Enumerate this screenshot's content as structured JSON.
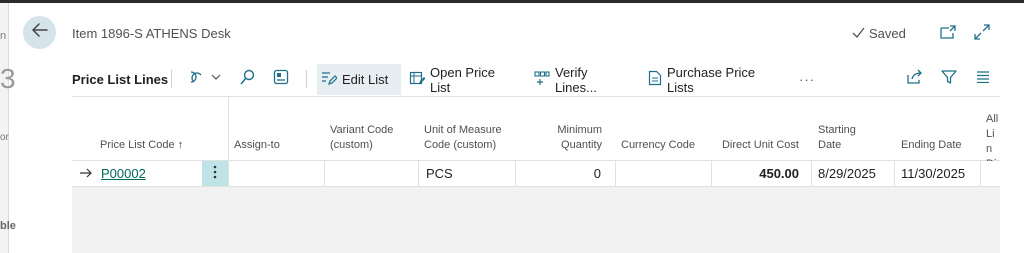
{
  "header": {
    "title": "Item 1896-S ATHENS Desk",
    "status": "Saved"
  },
  "left_fragments": [
    "n",
    "3",
    "or",
    "ble"
  ],
  "toolbar": {
    "title": "Price List Lines",
    "edit_list": "Edit List",
    "open_price_list": "Open Price List",
    "verify_lines": "Verify Lines...",
    "purchase_price_lists": "Purchase Price Lists",
    "more": "···"
  },
  "columns": {
    "price_list_code": "Price List Code",
    "sort_indicator": "↑",
    "assign_to": "Assign-to",
    "variant_code": "Variant Code (custom)",
    "unit_of_measure": "Unit of Measure Code (custom)",
    "min_quantity": "Minimum Quantity",
    "currency_code": "Currency Code",
    "direct_unit_cost": "Direct Unit Cost",
    "starting_date": "Starting Date",
    "ending_date": "Ending Date",
    "allow_line_disc_partial": "All Lin Dis"
  },
  "rows": [
    {
      "price_list_code": "P00002",
      "assign_to": "",
      "variant_code": "",
      "unit_of_measure": "PCS",
      "min_quantity": "0",
      "currency_code": "",
      "direct_unit_cost": "450.00",
      "starting_date": "8/29/2025",
      "ending_date": "11/30/2025"
    }
  ],
  "icons": {
    "back": "back-arrow-icon",
    "saved_check": "check-icon",
    "open_new": "open-in-new-window-icon",
    "expand": "expand-icon",
    "filter_pane": "filter-pane-icon",
    "search": "search-icon",
    "personalize": "personalize-icon",
    "share": "share-icon",
    "filter": "filter-icon",
    "list_view": "list-view-icon"
  },
  "colors": {
    "accent": "#00695c",
    "back_button_bg": "#d5e4ea",
    "active_cell": "#bfe3e6"
  }
}
